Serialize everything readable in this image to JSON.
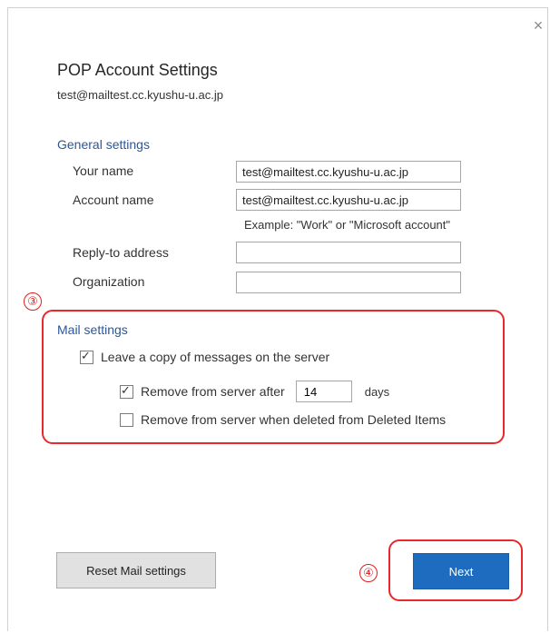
{
  "dialog": {
    "close_glyph": "×",
    "title": "POP Account Settings",
    "account_email": "test@mailtest.cc.kyushu-u.ac.jp"
  },
  "general": {
    "heading": "General settings",
    "your_name_label": "Your name",
    "your_name_value": "test@mailtest.cc.kyushu-u.ac.jp",
    "account_name_label": "Account name",
    "account_name_value": "test@mailtest.cc.kyushu-u.ac.jp",
    "account_name_example": "Example: \"Work\" or \"Microsoft account\"",
    "reply_to_label": "Reply-to address",
    "reply_to_value": "",
    "organization_label": "Organization",
    "organization_value": ""
  },
  "mail": {
    "heading": "Mail settings",
    "leave_copy_label": "Leave a copy of messages on the server",
    "leave_copy_checked": true,
    "remove_after_label": "Remove from server after",
    "remove_after_checked": true,
    "remove_after_days": "14",
    "days_label": "days",
    "remove_deleted_label": "Remove from server when deleted from Deleted Items",
    "remove_deleted_checked": false
  },
  "annotations": {
    "marker_3": "③",
    "marker_4": "④",
    "highlight_color": "#e8282b"
  },
  "buttons": {
    "reset_label": "Reset Mail settings",
    "next_label": "Next"
  },
  "colors": {
    "accent": "#2b579a",
    "primary_button": "#1e6cbf"
  }
}
